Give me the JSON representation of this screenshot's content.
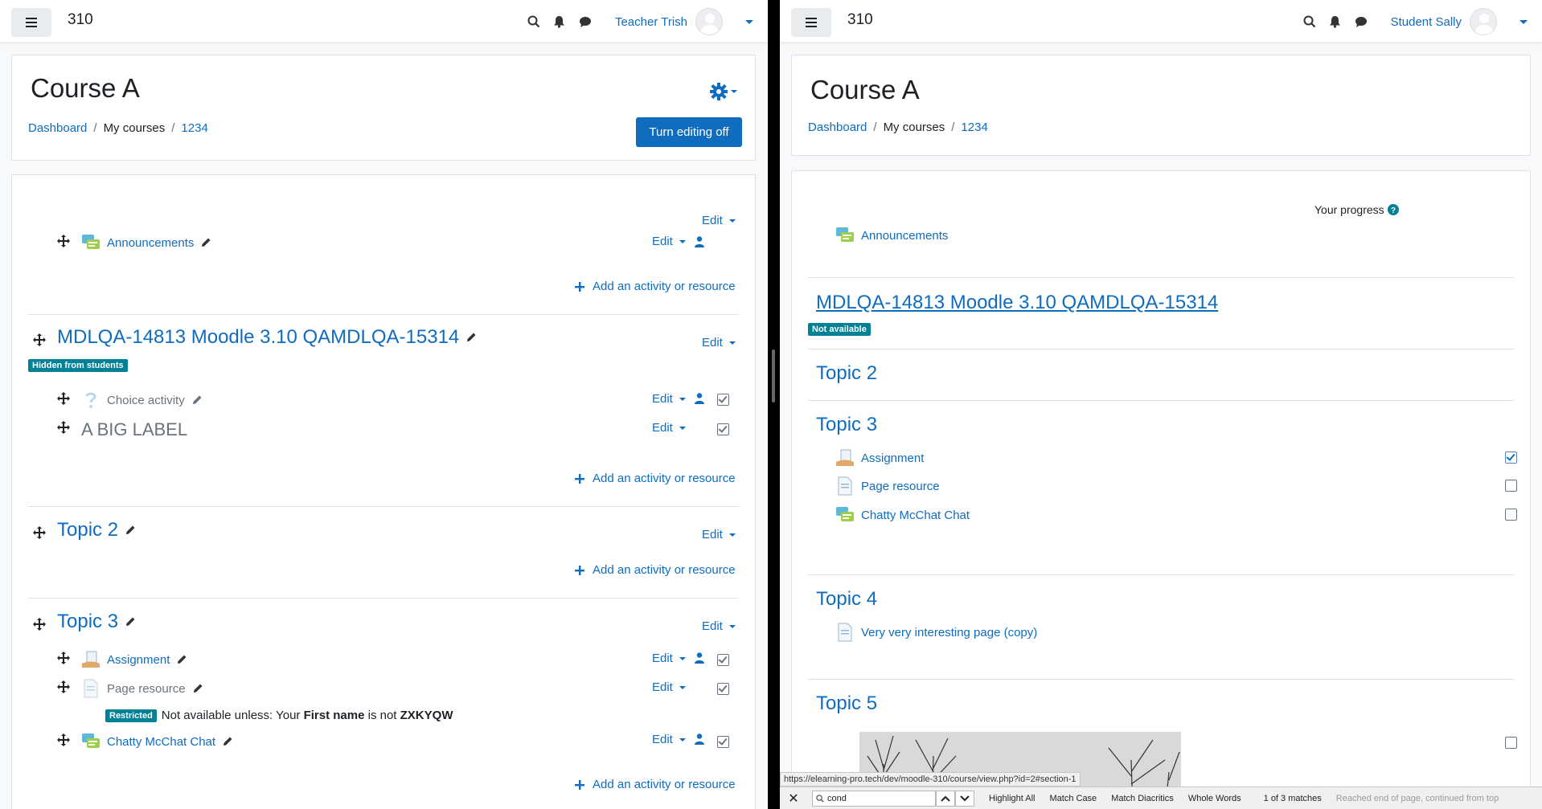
{
  "left": {
    "site_name": "310",
    "user_name": "Teacher Trish",
    "course_title": "Course A",
    "breadcrumb": [
      "Dashboard",
      "My courses",
      "1234"
    ],
    "turn_editing_label": "Turn editing off",
    "edit_label": "Edit",
    "add_activity_label": "Add an activity or resource",
    "general_section": {
      "activities": [
        {
          "name": "Announcements"
        }
      ]
    },
    "section1": {
      "title": "MDLQA-14813 Moodle 3.10 QAMDLQA-15314",
      "badge": "Hidden from students",
      "activities": [
        {
          "name": "Choice activity"
        },
        {
          "name": "A BIG LABEL"
        }
      ]
    },
    "section2": {
      "title": "Topic 2"
    },
    "section3": {
      "title": "Topic 3",
      "activities": [
        {
          "name": "Assignment"
        },
        {
          "name": "Page resource"
        },
        {
          "name": "Chatty McChat Chat"
        }
      ],
      "restriction": {
        "badge": "Restricted",
        "prefix": "Not available unless: Your ",
        "field": "First name",
        "middle": " is not ",
        "value": "ZXKYQW"
      }
    }
  },
  "right": {
    "site_name": "310",
    "user_name": "Student Sally",
    "course_title": "Course A",
    "breadcrumb": [
      "Dashboard",
      "My courses",
      "1234"
    ],
    "progress_label": "Your progress",
    "general_activities": [
      {
        "name": "Announcements"
      }
    ],
    "sections": [
      {
        "title": "MDLQA-14813 Moodle 3.10 QAMDLQA-15314",
        "badge": "Not available"
      },
      {
        "title": "Topic 2"
      },
      {
        "title": "Topic 3",
        "activities": [
          {
            "name": "Assignment",
            "completed": true
          },
          {
            "name": "Page resource",
            "completed": false
          },
          {
            "name": "Chatty McChat Chat",
            "completed": false
          }
        ]
      },
      {
        "title": "Topic 4",
        "activities": [
          {
            "name": "Very very interesting page (copy)"
          }
        ]
      },
      {
        "title": "Topic 5"
      }
    ],
    "status_url": "https://elearning-pro.tech/dev/moodle-310/course/view.php?id=2#section-1",
    "findbar": {
      "query": "cond",
      "highlight_all": "Highlight All",
      "match_case": "Match Case",
      "match_diacritics": "Match Diacritics",
      "whole_words": "Whole Words",
      "matches": "1 of 3 matches",
      "status": "Reached end of page, continued from top"
    }
  },
  "colors": {
    "link": "#0f6cbf",
    "badge": "#008196",
    "primary": "#0f6cbf"
  }
}
